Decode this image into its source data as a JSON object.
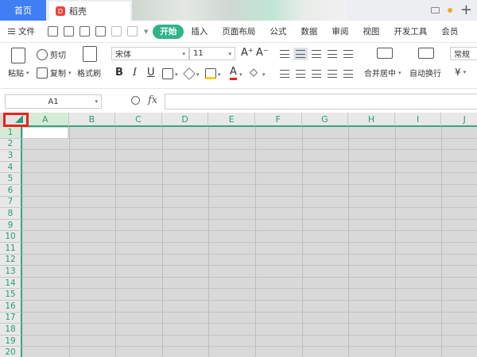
{
  "tabs": {
    "home": "首页",
    "doc": "稻壳",
    "doc_logo": "D"
  },
  "menu": {
    "file": "文件",
    "tabs": [
      "开始",
      "插入",
      "页面布局",
      "公式",
      "数据",
      "审阅",
      "视图",
      "开发工具",
      "会员"
    ]
  },
  "ribbon": {
    "paste": "粘贴",
    "cut": "剪切",
    "copy": "复制",
    "format_painter": "格式刷",
    "font_name": "宋体",
    "font_size": "11",
    "bold": "B",
    "italic": "I",
    "underline": "U",
    "merge_center": "合并居中",
    "wrap_text": "自动换行",
    "number_format": "常规",
    "currency": "¥",
    "font_grow": "A⁺",
    "font_shrink": "A⁻",
    "font_color": "A",
    "clear": "◇"
  },
  "formula": {
    "cell_ref": "A1",
    "fx_label": "fx",
    "value": ""
  },
  "grid": {
    "columns": [
      "A",
      "B",
      "C",
      "D",
      "E",
      "F",
      "G",
      "H",
      "I",
      "J"
    ],
    "rows": [
      "1",
      "2",
      "3",
      "4",
      "5",
      "6",
      "7",
      "8",
      "9",
      "10",
      "11",
      "12",
      "13",
      "14",
      "15",
      "16",
      "17",
      "18",
      "19",
      "20"
    ]
  },
  "colors": {
    "accent": "#2fb38a",
    "home_tab": "#3f7ef5",
    "highlight_box": "#e8231a",
    "grid_bg": "#d9d9d9"
  }
}
